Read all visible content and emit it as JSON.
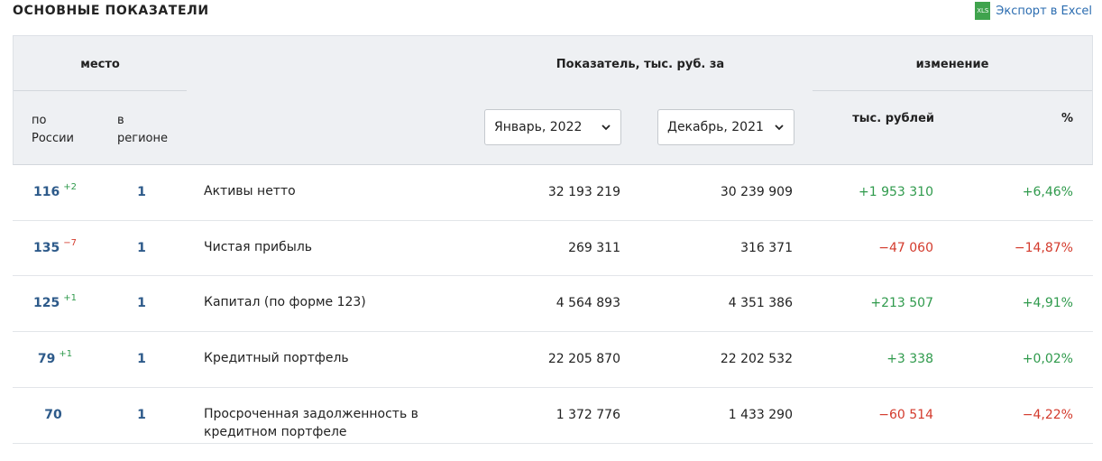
{
  "title": "ОСНОВНЫЕ ПОКАЗАТЕЛИ",
  "export": {
    "label": "Экспорт в Excel",
    "icon_text": "XLS"
  },
  "header": {
    "mesto": "место",
    "by_russia": [
      "по",
      "России"
    ],
    "in_region": [
      "в",
      "регионе"
    ],
    "indicator": "Показатель, тыс. руб. за",
    "change": "изменение",
    "change_thousands": "тыс. рублей",
    "change_percent": "%",
    "period_current": "Январь, 2022",
    "period_previous": "Декабрь, 2021"
  },
  "colors": {
    "positive": "#2f9a4c",
    "negative": "#d33a2c",
    "rank": "#2d5a8a",
    "header_bg": "#eef0f3"
  },
  "rows": [
    {
      "rank": "116",
      "rank_delta": "+2",
      "delta_dir": "pos",
      "region_rank": "1",
      "name": [
        "Активы нетто"
      ],
      "current": "32 193 219",
      "previous": "30 239 909",
      "change": "+1 953 310",
      "percent": "+6,46%",
      "dir": "pos"
    },
    {
      "rank": "135",
      "rank_delta": "−7",
      "delta_dir": "neg",
      "region_rank": "1",
      "name": [
        "Чистая прибыль"
      ],
      "current": "269 311",
      "previous": "316 371",
      "change": "−47 060",
      "percent": "−14,87%",
      "dir": "neg"
    },
    {
      "rank": "125",
      "rank_delta": "+1",
      "delta_dir": "pos",
      "region_rank": "1",
      "name": [
        "Капитал (по форме 123)"
      ],
      "current": "4 564 893",
      "previous": "4 351 386",
      "change": "+213 507",
      "percent": "+4,91%",
      "dir": "pos"
    },
    {
      "rank": "79",
      "rank_delta": "+1",
      "delta_dir": "pos",
      "region_rank": "1",
      "name": [
        "Кредитный портфель"
      ],
      "current": "22 205 870",
      "previous": "22 202 532",
      "change": "+3 338",
      "percent": "+0,02%",
      "dir": "pos"
    },
    {
      "rank": "70",
      "rank_delta": "",
      "delta_dir": "pos",
      "region_rank": "1",
      "name": [
        "Просроченная задолженность в",
        "кредитном портфеле"
      ],
      "current": "1 372 776",
      "previous": "1 433 290",
      "change": "−60 514",
      "percent": "−4,22%",
      "dir": "neg"
    }
  ]
}
